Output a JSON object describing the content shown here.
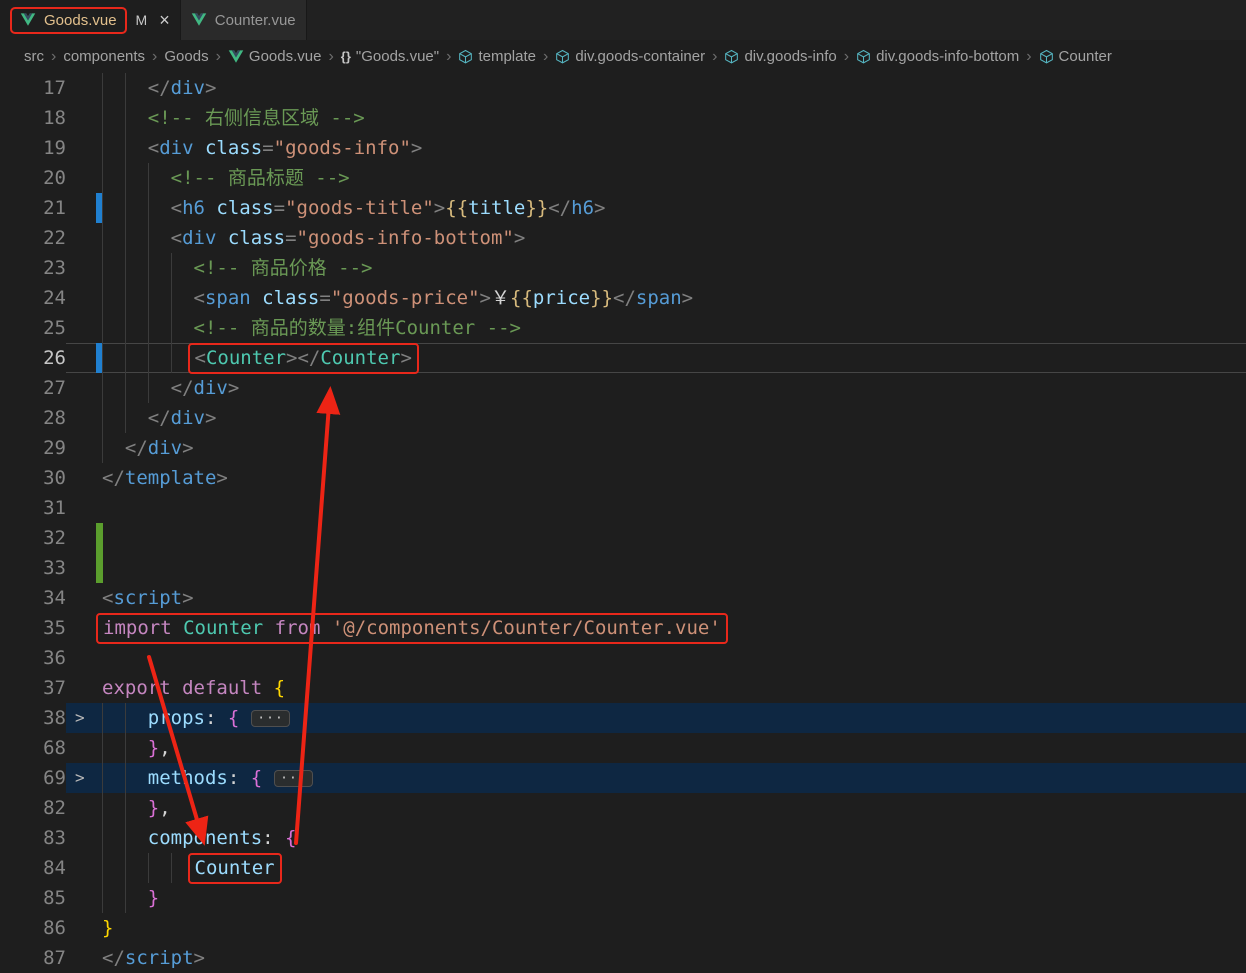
{
  "colors": {
    "annotation_red": "#e8281b",
    "modified_marker_blue": "#2080d0",
    "added_marker_green": "#5b9e2d",
    "tag_blue": "#569cd6",
    "component_teal": "#4ec9b0",
    "keyword_magenta": "#c586c0",
    "string_orange": "#ce9178",
    "comment_green": "#6a9955"
  },
  "tabs": [
    {
      "label": "Goods.vue",
      "badge": "M",
      "close": "×",
      "active": true,
      "annotated": true
    },
    {
      "label": "Counter.vue",
      "badge": "",
      "close": "",
      "active": false,
      "annotated": false
    }
  ],
  "breadcrumbs": [
    {
      "label": "src",
      "icon": ""
    },
    {
      "label": "components",
      "icon": ""
    },
    {
      "label": "Goods",
      "icon": ""
    },
    {
      "label": "Goods.vue",
      "icon": "vue"
    },
    {
      "label": "\"Goods.vue\"",
      "icon": "braces"
    },
    {
      "label": "template",
      "icon": "cube"
    },
    {
      "label": "div.goods-container",
      "icon": "cube"
    },
    {
      "label": "div.goods-info",
      "icon": "cube"
    },
    {
      "label": "div.goods-info-bottom",
      "icon": "cube"
    },
    {
      "label": "Counter",
      "icon": "cube"
    }
  ],
  "editor": {
    "fold_dots": "···",
    "lines": [
      {
        "num": 17,
        "indent": 4,
        "segments": [
          [
            "p",
            "</"
          ],
          [
            "t",
            "div"
          ],
          [
            "p",
            ">"
          ]
        ]
      },
      {
        "num": 18,
        "indent": 4,
        "segments": [
          [
            "c",
            "<!-- 右侧信息区域 -->"
          ]
        ]
      },
      {
        "num": 19,
        "indent": 4,
        "segments": [
          [
            "p",
            "<"
          ],
          [
            "t",
            "div"
          ],
          [
            "w",
            " "
          ],
          [
            "a",
            "class"
          ],
          [
            "p",
            "="
          ],
          [
            "s",
            "\"goods-info\""
          ],
          [
            "p",
            ">"
          ]
        ]
      },
      {
        "num": 20,
        "indent": 6,
        "segments": [
          [
            "c",
            "<!-- 商品标题 -->"
          ]
        ]
      },
      {
        "num": 21,
        "indent": 6,
        "marker": "mod",
        "segments": [
          [
            "p",
            "<"
          ],
          [
            "t",
            "h6"
          ],
          [
            "w",
            " "
          ],
          [
            "a",
            "class"
          ],
          [
            "p",
            "="
          ],
          [
            "s",
            "\"goods-title\""
          ],
          [
            "p",
            ">"
          ],
          [
            "ib",
            "{{"
          ],
          [
            "v",
            "title"
          ],
          [
            "ib",
            "}}"
          ],
          [
            "p",
            "</"
          ],
          [
            "t",
            "h6"
          ],
          [
            "p",
            ">"
          ]
        ]
      },
      {
        "num": 22,
        "indent": 6,
        "segments": [
          [
            "p",
            "<"
          ],
          [
            "t",
            "div"
          ],
          [
            "w",
            " "
          ],
          [
            "a",
            "class"
          ],
          [
            "p",
            "="
          ],
          [
            "s",
            "\"goods-info-bottom\""
          ],
          [
            "p",
            ">"
          ]
        ]
      },
      {
        "num": 23,
        "indent": 8,
        "segments": [
          [
            "c",
            "<!-- 商品价格 -->"
          ]
        ]
      },
      {
        "num": 24,
        "indent": 8,
        "segments": [
          [
            "p",
            "<"
          ],
          [
            "t",
            "span"
          ],
          [
            "w",
            " "
          ],
          [
            "a",
            "class"
          ],
          [
            "p",
            "="
          ],
          [
            "s",
            "\"goods-price\""
          ],
          [
            "p",
            ">"
          ],
          [
            "w",
            "￥"
          ],
          [
            "ib",
            "{{"
          ],
          [
            "v",
            "price"
          ],
          [
            "ib",
            "}}"
          ],
          [
            "p",
            "</"
          ],
          [
            "t",
            "span"
          ],
          [
            "p",
            ">"
          ]
        ]
      },
      {
        "num": 25,
        "indent": 8,
        "segments": [
          [
            "c",
            "<!-- 商品的数量:组件Counter -->"
          ]
        ]
      },
      {
        "num": 26,
        "indent": 8,
        "marker": "mod",
        "hl": "cur",
        "active": true,
        "box": true,
        "segments": [
          [
            "p",
            "<"
          ],
          [
            "n",
            "Counter"
          ],
          [
            "p",
            "></"
          ],
          [
            "n",
            "Counter"
          ],
          [
            "p",
            ">"
          ]
        ]
      },
      {
        "num": 27,
        "indent": 6,
        "segments": [
          [
            "p",
            "</"
          ],
          [
            "t",
            "div"
          ],
          [
            "p",
            ">"
          ]
        ]
      },
      {
        "num": 28,
        "indent": 4,
        "segments": [
          [
            "p",
            "</"
          ],
          [
            "t",
            "div"
          ],
          [
            "p",
            ">"
          ]
        ]
      },
      {
        "num": 29,
        "indent": 2,
        "segments": [
          [
            "p",
            "</"
          ],
          [
            "t",
            "div"
          ],
          [
            "p",
            ">"
          ]
        ]
      },
      {
        "num": 30,
        "indent": 0,
        "segments": [
          [
            "p",
            "</"
          ],
          [
            "t",
            "template"
          ],
          [
            "p",
            ">"
          ]
        ]
      },
      {
        "num": 31,
        "indent": 0,
        "segments": []
      },
      {
        "num": 32,
        "indent": 0,
        "marker": "add",
        "segments": []
      },
      {
        "num": 33,
        "indent": 0,
        "marker": "add",
        "segments": []
      },
      {
        "num": 34,
        "indent": 0,
        "segments": [
          [
            "p",
            "<"
          ],
          [
            "t",
            "script"
          ],
          [
            "p",
            ">"
          ]
        ]
      },
      {
        "num": 35,
        "indent": 0,
        "box": true,
        "segments": [
          [
            "k",
            "import"
          ],
          [
            "w",
            " "
          ],
          [
            "n",
            "Counter"
          ],
          [
            "w",
            " "
          ],
          [
            "k",
            "from"
          ],
          [
            "w",
            " "
          ],
          [
            "s",
            "'@/components/Counter/Counter.vue'"
          ]
        ]
      },
      {
        "num": 36,
        "indent": 0,
        "segments": []
      },
      {
        "num": 37,
        "indent": 0,
        "segments": [
          [
            "k",
            "export"
          ],
          [
            "w",
            " "
          ],
          [
            "k",
            "default"
          ],
          [
            "w",
            " "
          ],
          [
            "g1",
            "{"
          ]
        ]
      },
      {
        "num": 38,
        "indent": 4,
        "fold": true,
        "hl": "sel",
        "badge": true,
        "segments": [
          [
            "a",
            "props"
          ],
          [
            "w",
            ": "
          ],
          [
            "g2",
            "{"
          ]
        ]
      },
      {
        "num": 68,
        "indent": 4,
        "segments": [
          [
            "g2",
            "}"
          ],
          [
            "w",
            ","
          ]
        ]
      },
      {
        "num": 69,
        "indent": 4,
        "fold": true,
        "hl": "sel",
        "badge": true,
        "segments": [
          [
            "a",
            "methods"
          ],
          [
            "w",
            ": "
          ],
          [
            "g2",
            "{"
          ]
        ]
      },
      {
        "num": 82,
        "indent": 4,
        "segments": [
          [
            "g2",
            "}"
          ],
          [
            "w",
            ","
          ]
        ]
      },
      {
        "num": 83,
        "indent": 4,
        "segments": [
          [
            "a",
            "components"
          ],
          [
            "w",
            ": "
          ],
          [
            "g2",
            "{"
          ]
        ]
      },
      {
        "num": 84,
        "indent": 8,
        "box": true,
        "segments": [
          [
            "v",
            "Counter"
          ]
        ]
      },
      {
        "num": 85,
        "indent": 4,
        "segments": [
          [
            "g2",
            "}"
          ]
        ]
      },
      {
        "num": 86,
        "indent": 0,
        "segments": [
          [
            "g1",
            "}"
          ]
        ]
      },
      {
        "num": 87,
        "indent": 0,
        "segments": [
          [
            "p",
            "</"
          ],
          [
            "t",
            "script"
          ],
          [
            "p",
            ">"
          ]
        ]
      }
    ]
  }
}
